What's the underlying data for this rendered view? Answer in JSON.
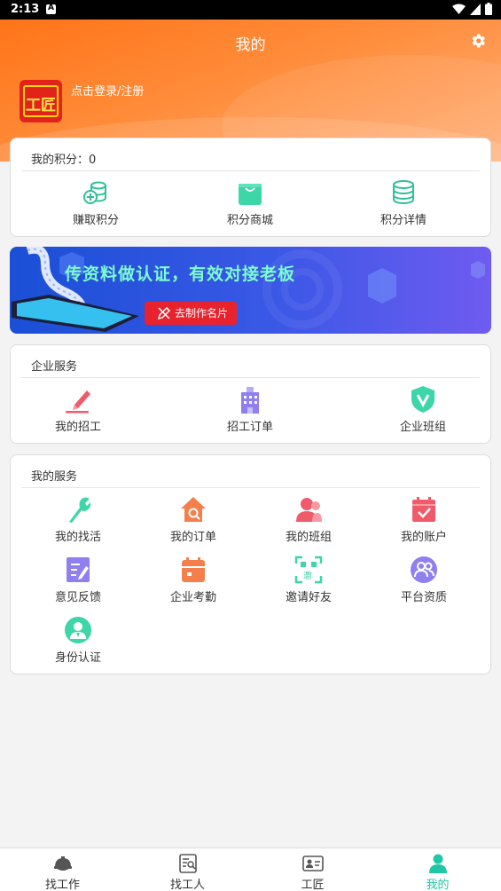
{
  "status_bar": {
    "time": "2:13"
  },
  "header": {
    "title": "我的",
    "login_text": "点击登录/注册",
    "logo_text": "工匠"
  },
  "points_card": {
    "label": "我的积分：0",
    "items": [
      {
        "label": "赚取积分",
        "icon": "coins-plus-icon"
      },
      {
        "label": "积分商城",
        "icon": "shopping-bag-icon"
      },
      {
        "label": "积分详情",
        "icon": "coin-stack-icon"
      }
    ]
  },
  "banner": {
    "headline": "传资料做认证，有效对接老板",
    "button": "去制作名片"
  },
  "enterprise": {
    "title": "企业服务",
    "items": [
      {
        "label": "我的招工",
        "icon": "pen-icon"
      },
      {
        "label": "招工订单",
        "icon": "building-icon"
      },
      {
        "label": "企业班组",
        "icon": "shield-v-icon"
      }
    ]
  },
  "my_services": {
    "title": "我的服务",
    "items": [
      {
        "label": "我的找活",
        "icon": "wrench-icon"
      },
      {
        "label": "我的订单",
        "icon": "house-search-icon"
      },
      {
        "label": "我的班组",
        "icon": "group-icon"
      },
      {
        "label": "我的账户",
        "icon": "calendar-check-icon"
      },
      {
        "label": "意见反馈",
        "icon": "edit-doc-icon"
      },
      {
        "label": "企业考勤",
        "icon": "calendar-icon"
      },
      {
        "label": "邀请好友",
        "icon": "qr-invite-icon"
      },
      {
        "label": "平台资质",
        "icon": "people-circle-icon"
      },
      {
        "label": "身份认证",
        "icon": "id-person-icon"
      }
    ]
  },
  "tabbar": {
    "tabs": [
      {
        "label": "找工作",
        "icon": "hardhat-icon"
      },
      {
        "label": "找工人",
        "icon": "resume-search-icon"
      },
      {
        "label": "工匠",
        "icon": "id-card-icon"
      },
      {
        "label": "我的",
        "icon": "profile-icon"
      }
    ],
    "active": "我的",
    "accent": "#1fc7a4"
  },
  "colors": {
    "header": "#ff7418",
    "banner": "#2d56e0",
    "banner_button": "#e8232e"
  }
}
